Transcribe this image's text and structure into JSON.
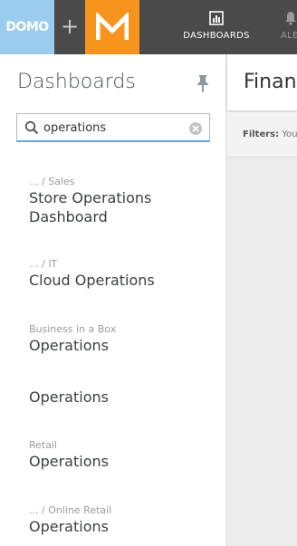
{
  "topbar": {
    "domo_logo": "DOMO",
    "plus": "+",
    "m_logo": "M",
    "nav": {
      "dashboards_label": "DASHBOARDS",
      "alerts_label": "ALERTS"
    }
  },
  "sidebar": {
    "title": "Dashboards",
    "search": {
      "value": "operations",
      "placeholder": ""
    },
    "items": [
      {
        "path": "... / Sales",
        "name": "Store Operations Dashboard"
      },
      {
        "path": "... / IT",
        "name": "Cloud Operations"
      },
      {
        "path": "Business in a Box",
        "name": "Operations"
      },
      {
        "path": "",
        "name": "Operations"
      },
      {
        "path": "Retail",
        "name": "Operations"
      },
      {
        "path": "... / Online Retail",
        "name": "Operations"
      }
    ]
  },
  "main": {
    "title": "Finance",
    "filters_label": "Filters:",
    "filters_value": "Your filters"
  },
  "colors": {
    "topbar": "#4a4a4a",
    "domo_blue": "#99ccee",
    "m_orange": "#f7941d",
    "search_underline": "#5aa9e6"
  }
}
